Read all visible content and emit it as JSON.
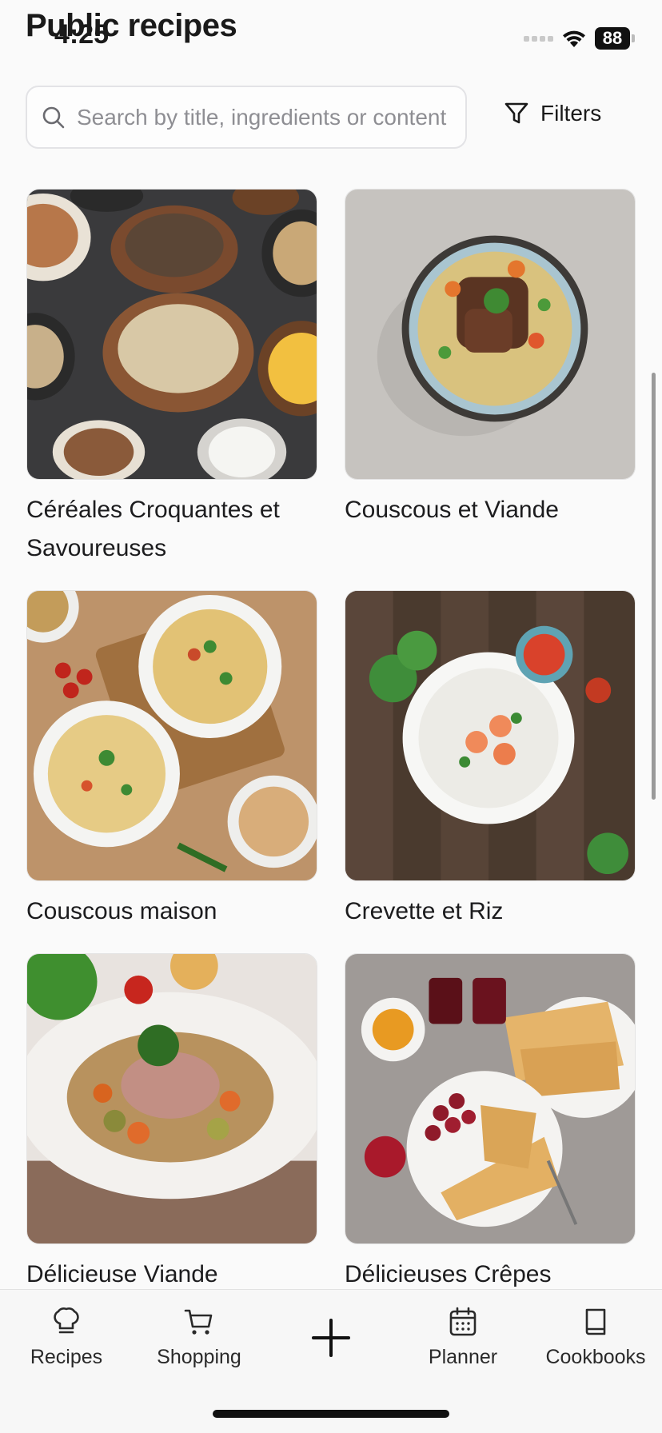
{
  "status_bar": {
    "time": "4:25",
    "battery": "88"
  },
  "page": {
    "title": "Public recipes"
  },
  "search": {
    "placeholder": "Search by title, ingredients or content",
    "value": ""
  },
  "filters": {
    "label": "Filters"
  },
  "recipes": [
    {
      "title": "Céréales Croquantes et Savoureuses"
    },
    {
      "title": "Couscous et Viande"
    },
    {
      "title": "Couscous maison"
    },
    {
      "title": "Crevette et Riz"
    },
    {
      "title": "Délicieuse Viande"
    },
    {
      "title": "Délicieuses Crêpes"
    }
  ],
  "tabbar": {
    "recipes": "Recipes",
    "shopping": "Shopping",
    "planner": "Planner",
    "cookbooks": "Cookbooks"
  }
}
